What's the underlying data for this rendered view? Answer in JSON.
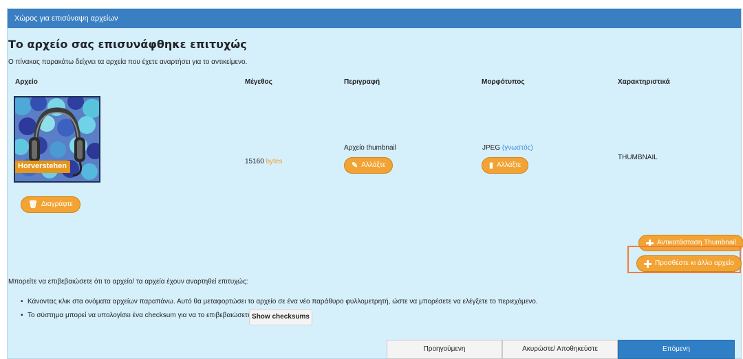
{
  "panel": {
    "header_title": "Χώρος για επισύναψη αρχείων",
    "title": "Το αρχείο σας επισυνάφθηκε επιτυχώς",
    "subtitle": "Ο πίνακας παρακάτω δείχνει τα αρχεία που έχετε αναρτήσει για το αντικείμενο."
  },
  "table": {
    "headers": {
      "file": "Αρχείο",
      "size": "Μέγεθος",
      "description": "Περιγραφή",
      "format": "Μορφότυπος",
      "features": "Χαρακτηριστικά"
    },
    "row": {
      "thumbnail_caption": "Horverstehen",
      "size_value": "15160",
      "size_unit": "bytes",
      "description": "Αρχείο thumbnail",
      "format": "JPEG",
      "format_status": "(γνωστός)",
      "features": "THUMBNAIL",
      "delete_label": "Διαγράφτε",
      "change_description_label": "Αλλάξτε",
      "change_format_label": "Αλλάξτε"
    }
  },
  "actions": {
    "replace_thumbnail": "Αντικατάσταση Thumbnail",
    "add_file": "Προσθέστε κι άλλο αρχείο"
  },
  "verify": {
    "intro": "Μπορείτε να επιβεβαιώσετε ότι το αρχείο/ τα αρχεία έχουν αναρτηθεί επιτυχώς:",
    "bullet1": "Κάνοντας κλικ στα ονόματα αρχείων παραπάνω. Αυτό θα μεταφορτώσει το αρχείο σε ένα νέο παράθυρο φυλλομετρητή, ώστε να μπορέσετε να ελέγξετε το περιεχόμενο.",
    "bullet2": "Το σύστημα μπορεί να υπολογίσει ένα checksum για να το επιβεβαιώσετε.",
    "show_checksums": "Show checksums"
  },
  "nav": {
    "previous": "Προηγούμενη",
    "cancel": "Ακυρώστε/ Αποθηκεύστε",
    "next": "Επόμενη"
  },
  "colors": {
    "header_blue": "#3a7fc2",
    "panel_bg": "#d5effb",
    "orange_button": "#f2a333",
    "highlight": "#ef7d3e",
    "next_button": "#2f7ec6"
  },
  "icons": [
    "trash-icon",
    "pencil-icon",
    "file-icon",
    "plus-icon"
  ]
}
